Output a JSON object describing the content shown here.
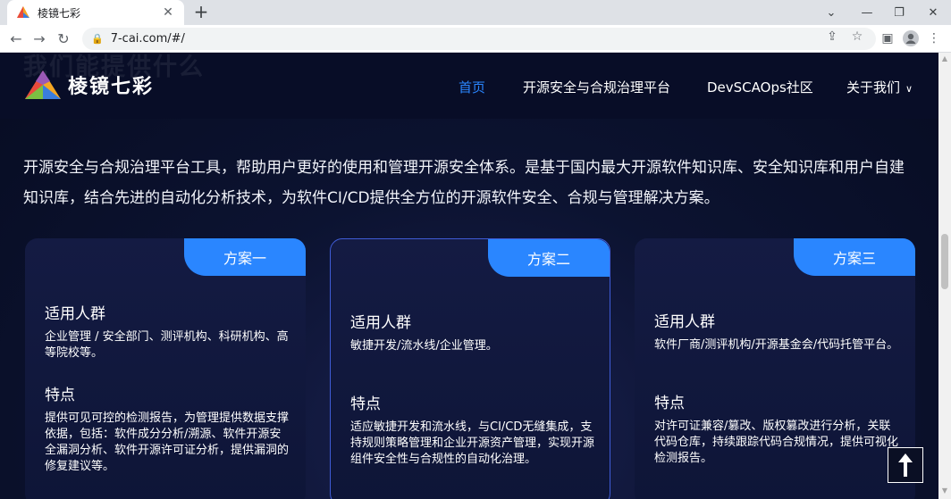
{
  "browser": {
    "tab_title": "棱镜七彩",
    "url": "7-cai.com/#/"
  },
  "header": {
    "ghost_title": "我们能提供什么",
    "logo_text": "棱镜七彩",
    "nav": [
      {
        "label": "首页",
        "active": true
      },
      {
        "label": "开源安全与合规治理平台",
        "active": false
      },
      {
        "label": "DevSCAOps社区",
        "active": false
      },
      {
        "label": "关于我们",
        "active": false
      }
    ]
  },
  "intro": "开源安全与合规治理平台工具，帮助用户更好的使用和管理开源安全体系。是基于国内最大开源软件知识库、安全知识库和用户自建知识库，结合先进的自动化分析技术，为软件CI/CD提供全方位的开源软件安全、合规与管理解决方案。",
  "cards": [
    {
      "badge": "方案一",
      "audience_title": "适用人群",
      "audience": "企业管理 / 安全部门、测评机构、科研机构、高等院校等。",
      "feature_title": "特点",
      "feature": "提供可见可控的检测报告，为管理提供数据支撑依据，包括：软件成分分析/溯源、软件开源安全漏洞分析、软件开源许可证分析，提供漏洞的修复建议等。"
    },
    {
      "badge": "方案二",
      "audience_title": "适用人群",
      "audience": "敏捷开发/流水线/企业管理。",
      "feature_title": "特点",
      "feature": "适应敏捷开发和流水线，与CI/CD无缝集成，支持规则策略管理和企业开源资产管理，实现开源组件安全性与合规性的自动化治理。"
    },
    {
      "badge": "方案三",
      "audience_title": "适用人群",
      "audience": "软件厂商/测评机构/开源基金会/代码托管平台。",
      "feature_title": "特点",
      "feature": "对许可证兼容/篡改、版权篡改进行分析，关联代码仓库，持续跟踪代码合规情况，提供可视化检测报告。"
    }
  ],
  "colors": {
    "accent": "#2a86ff",
    "page_bg": "#0b1230",
    "card_border_active": "#3f5cd6"
  }
}
